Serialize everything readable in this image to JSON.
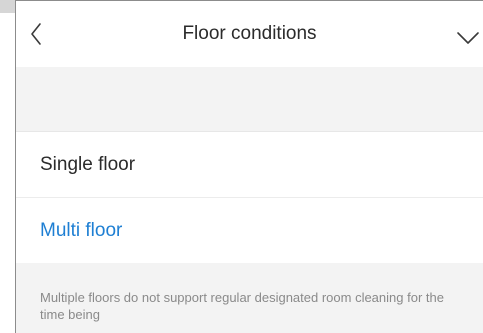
{
  "header": {
    "title": "Floor conditions",
    "back_icon": "chevron-left-icon",
    "confirm_icon": "chevron-down-icon"
  },
  "options": [
    {
      "label": "Single floor",
      "selected": false
    },
    {
      "label": "Multi floor",
      "selected": true
    }
  ],
  "note": "Multiple floors do not support regular designated room cleaning for the time being",
  "colors": {
    "accent": "#1e7fd3",
    "text": "#2b2b2b",
    "muted_text": "#8a8a8a",
    "background": "#f3f3f3"
  }
}
